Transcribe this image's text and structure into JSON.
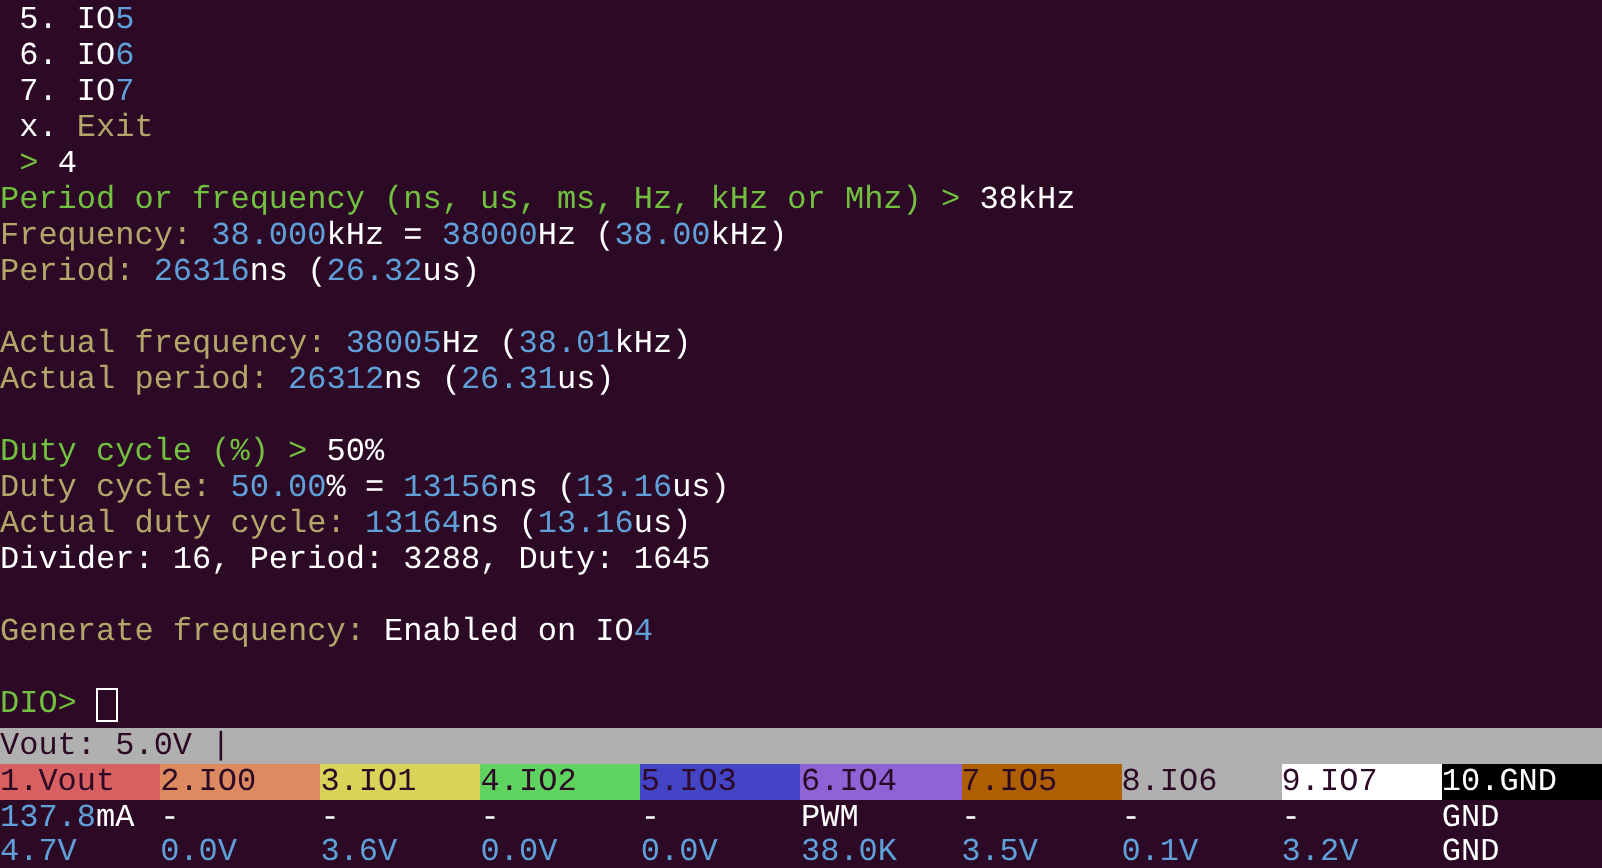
{
  "terminal": {
    "lines": [
      {
        "kind": "text",
        "segments": [
          {
            "text": " 5. IO",
            "kind": "plain"
          },
          {
            "text": "5",
            "kind": "number"
          }
        ]
      },
      {
        "kind": "text",
        "segments": [
          {
            "text": " 6. IO",
            "kind": "plain"
          },
          {
            "text": "6",
            "kind": "number"
          }
        ]
      },
      {
        "kind": "text",
        "segments": [
          {
            "text": " 7. IO",
            "kind": "plain"
          },
          {
            "text": "7",
            "kind": "number"
          }
        ]
      },
      {
        "kind": "text",
        "segments": [
          {
            "text": " x. ",
            "kind": "plain"
          },
          {
            "text": "Exit",
            "kind": "label"
          }
        ]
      },
      {
        "kind": "text",
        "segments": [
          {
            "text": " > ",
            "kind": "prompt"
          },
          {
            "text": "4",
            "kind": "plain"
          }
        ]
      },
      {
        "kind": "text",
        "segments": [
          {
            "text": "Period or frequency (ns, us, ms, Hz, kHz or Mhz) > ",
            "kind": "prompt"
          },
          {
            "text": "38kHz",
            "kind": "plain"
          }
        ]
      },
      {
        "kind": "text",
        "segments": [
          {
            "text": "Frequency: ",
            "kind": "label"
          },
          {
            "text": "38.000",
            "kind": "number"
          },
          {
            "text": "kHz = ",
            "kind": "plain"
          },
          {
            "text": "38000",
            "kind": "number"
          },
          {
            "text": "Hz (",
            "kind": "plain"
          },
          {
            "text": "38.00",
            "kind": "number"
          },
          {
            "text": "kHz)",
            "kind": "plain"
          }
        ]
      },
      {
        "kind": "text",
        "segments": [
          {
            "text": "Period: ",
            "kind": "label"
          },
          {
            "text": "26316",
            "kind": "number"
          },
          {
            "text": "ns (",
            "kind": "plain"
          },
          {
            "text": "26.32",
            "kind": "number"
          },
          {
            "text": "us)",
            "kind": "plain"
          }
        ]
      },
      {
        "kind": "blank"
      },
      {
        "kind": "text",
        "segments": [
          {
            "text": "Actual frequency: ",
            "kind": "label"
          },
          {
            "text": "38005",
            "kind": "number"
          },
          {
            "text": "Hz (",
            "kind": "plain"
          },
          {
            "text": "38.01",
            "kind": "number"
          },
          {
            "text": "kHz)",
            "kind": "plain"
          }
        ]
      },
      {
        "kind": "text",
        "segments": [
          {
            "text": "Actual period: ",
            "kind": "label"
          },
          {
            "text": "26312",
            "kind": "number"
          },
          {
            "text": "ns (",
            "kind": "plain"
          },
          {
            "text": "26.31",
            "kind": "number"
          },
          {
            "text": "us)",
            "kind": "plain"
          }
        ]
      },
      {
        "kind": "blank"
      },
      {
        "kind": "text",
        "segments": [
          {
            "text": "Duty cycle (%) > ",
            "kind": "prompt"
          },
          {
            "text": "50%",
            "kind": "plain"
          }
        ]
      },
      {
        "kind": "text",
        "segments": [
          {
            "text": "Duty cycle: ",
            "kind": "label"
          },
          {
            "text": "50.00",
            "kind": "number"
          },
          {
            "text": "% = ",
            "kind": "plain"
          },
          {
            "text": "13156",
            "kind": "number"
          },
          {
            "text": "ns (",
            "kind": "plain"
          },
          {
            "text": "13.16",
            "kind": "number"
          },
          {
            "text": "us)",
            "kind": "plain"
          }
        ]
      },
      {
        "kind": "text",
        "segments": [
          {
            "text": "Actual duty cycle: ",
            "kind": "label"
          },
          {
            "text": "13164",
            "kind": "number"
          },
          {
            "text": "ns (",
            "kind": "plain"
          },
          {
            "text": "13.16",
            "kind": "number"
          },
          {
            "text": "us)",
            "kind": "plain"
          }
        ]
      },
      {
        "kind": "text",
        "segments": [
          {
            "text": "Divider: 16, Period: 3288, Duty: 1645",
            "kind": "plain"
          }
        ]
      },
      {
        "kind": "blank"
      },
      {
        "kind": "text",
        "segments": [
          {
            "text": "Generate frequency: ",
            "kind": "label"
          },
          {
            "text": "Enabled on IO",
            "kind": "plain"
          },
          {
            "text": "4",
            "kind": "number"
          }
        ]
      },
      {
        "kind": "blank"
      }
    ],
    "prompt": "DIO> "
  },
  "status_bar": {
    "vout": "Vout: 5.0V |",
    "pins": [
      {
        "label": "1.Vout",
        "color": "#d96060",
        "dark_text": true
      },
      {
        "label": "2.IO0",
        "color": "#dd8a60",
        "dark_text": true
      },
      {
        "label": "3.IO1",
        "color": "#d9d35a",
        "dark_text": true
      },
      {
        "label": "4.IO2",
        "color": "#5fd35f",
        "dark_text": true
      },
      {
        "label": "5.IO3",
        "color": "#4444c6",
        "dark_text": true
      },
      {
        "label": "6.IO4",
        "color": "#8f63d6",
        "dark_text": true
      },
      {
        "label": "7.IO5",
        "color": "#b05f00",
        "dark_text": true
      },
      {
        "label": "8.IO6",
        "color": "#b0b0b0",
        "dark_text": true
      },
      {
        "label": "9.IO7",
        "color": "#ffffff",
        "dark_text": true
      },
      {
        "label": "10.GND",
        "color": "#000000",
        "dark_text": false
      }
    ],
    "rows": [
      [
        [
          {
            "text": "137.8",
            "kind": "number"
          },
          {
            "text": "mA",
            "kind": "plain"
          }
        ],
        [
          {
            "text": "-",
            "kind": "plain"
          }
        ],
        [
          {
            "text": "-",
            "kind": "plain"
          }
        ],
        [
          {
            "text": "-",
            "kind": "plain"
          }
        ],
        [
          {
            "text": "-",
            "kind": "plain"
          }
        ],
        [
          {
            "text": "PWM",
            "kind": "plain"
          }
        ],
        [
          {
            "text": "-",
            "kind": "plain"
          }
        ],
        [
          {
            "text": "-",
            "kind": "plain"
          }
        ],
        [
          {
            "text": "-",
            "kind": "plain"
          }
        ],
        [
          {
            "text": "GND",
            "kind": "plain"
          }
        ]
      ],
      [
        [
          {
            "text": "4.7V",
            "kind": "number"
          }
        ],
        [
          {
            "text": "0.0V",
            "kind": "number"
          }
        ],
        [
          {
            "text": "3.6V",
            "kind": "number"
          }
        ],
        [
          {
            "text": "0.0V",
            "kind": "number"
          }
        ],
        [
          {
            "text": "0.0V",
            "kind": "number"
          }
        ],
        [
          {
            "text": "38.0K",
            "kind": "number"
          }
        ],
        [
          {
            "text": "3.5V",
            "kind": "number"
          }
        ],
        [
          {
            "text": "0.1V",
            "kind": "number"
          }
        ],
        [
          {
            "text": "3.2V",
            "kind": "number"
          }
        ],
        [
          {
            "text": "GND",
            "kind": "plain"
          }
        ]
      ]
    ]
  }
}
